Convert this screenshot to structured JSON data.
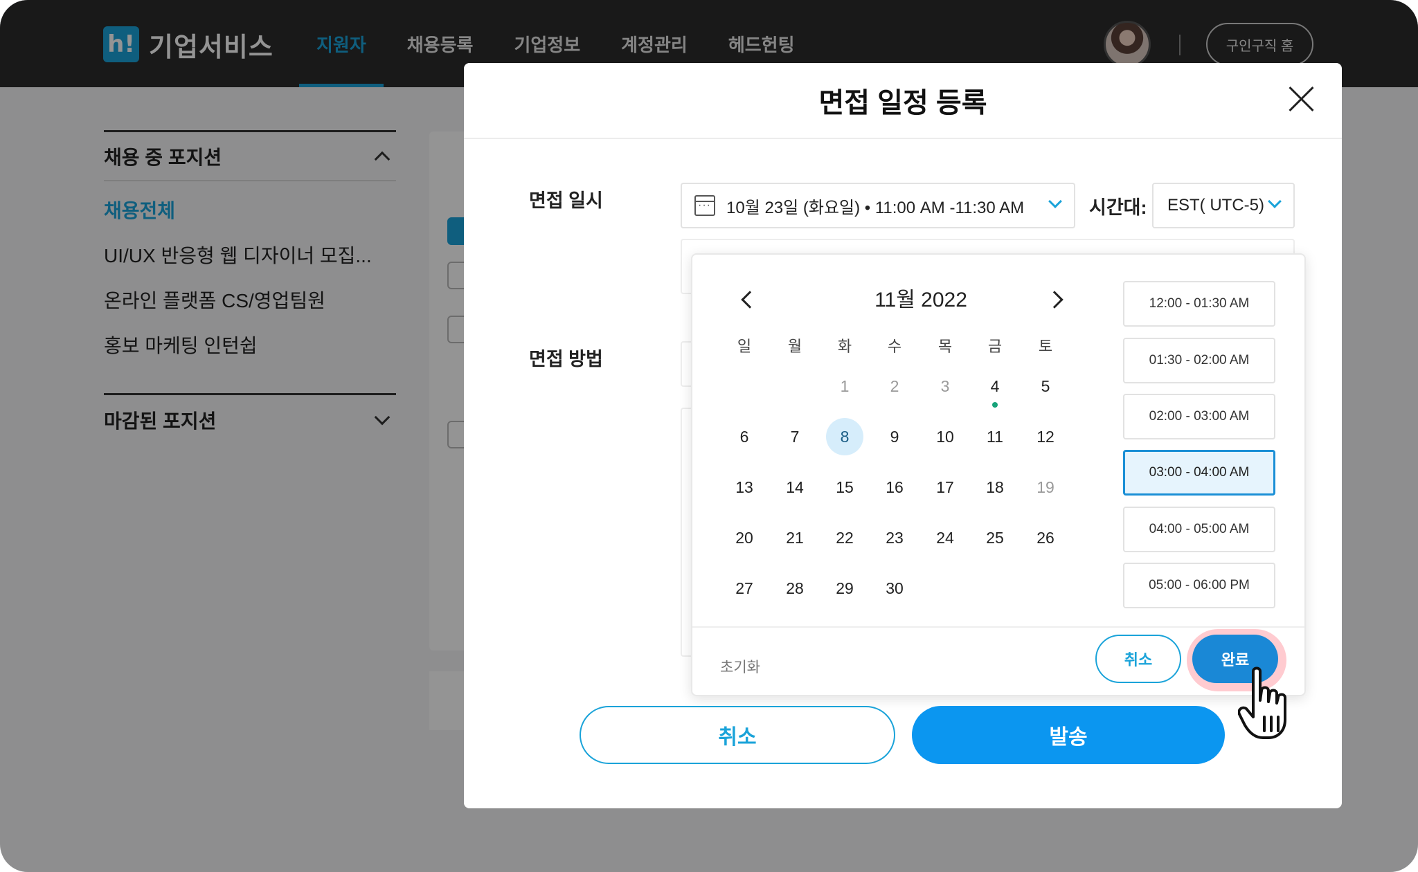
{
  "header": {
    "logo_mark": "h!",
    "logo_text": "기업서비스",
    "nav": [
      "지원자",
      "채용등록",
      "기업정보",
      "계정관리",
      "헤드헌팅"
    ],
    "active_nav": "지원자",
    "home_button": "구인구직 홈"
  },
  "sidebar": {
    "open_section": "채용 중 포지션",
    "items": [
      "채용전체",
      "UI/UX 반응형 웹 디자이너 모집...",
      "온라인 플랫폼 CS/영업팀원",
      "홍보 마케팅 인턴쉽"
    ],
    "closed_section": "마감된 포지션"
  },
  "modal": {
    "title": "면접 일정 등록",
    "datetime_label": "면접 일시",
    "method_label": "면접 방법",
    "selected_datetime": "10월 23일 (화요일) • 11:00 AM -11:30 AM",
    "timezone_label": "시간대:",
    "timezone_value": "EST( UTC-5)",
    "cancel_button": "취소",
    "send_button": "발송"
  },
  "picker": {
    "month_title": "11월 2022",
    "weekdays": [
      "일",
      "월",
      "화",
      "수",
      "목",
      "금",
      "토"
    ],
    "days": [
      "1",
      "2",
      "3",
      "4",
      "5",
      "6",
      "7",
      "8",
      "9",
      "10",
      "11",
      "12",
      "13",
      "14",
      "15",
      "16",
      "17",
      "18",
      "19",
      "20",
      "21",
      "22",
      "23",
      "24",
      "25",
      "26",
      "27",
      "28",
      "29",
      "30"
    ],
    "selected_day": "8",
    "marked_day": "4",
    "time_slots": [
      "12:00 - 01:30 AM",
      "01:30 - 02:00 AM",
      "02:00 - 03:00 AM",
      "03:00 - 04:00 AM",
      "04:00 - 05:00 AM",
      "05:00 - 06:00 PM"
    ],
    "selected_slot": "03:00 - 04:00 AM",
    "reset_label": "초기화",
    "cancel_label": "취소",
    "done_label": "완료"
  },
  "colors": {
    "accent": "#1aa3d9",
    "primary_button": "#0b96f0",
    "header_bg": "#2b2b2b",
    "selected_day_bg": "#d6edfb",
    "marker_dot": "#17a37a"
  }
}
